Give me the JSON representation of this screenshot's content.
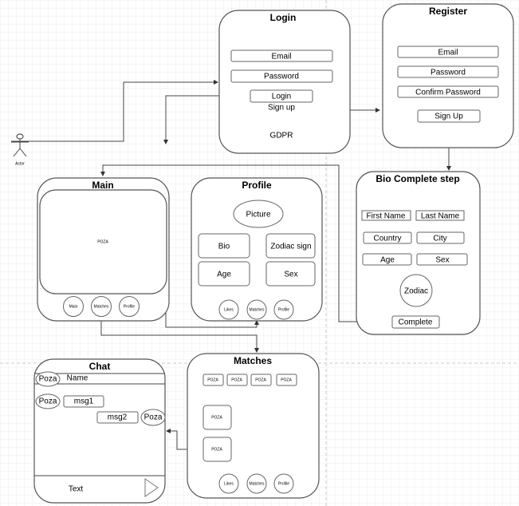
{
  "actor": {
    "label": "Actor"
  },
  "login": {
    "title": "Login",
    "email": "Email",
    "password": "Password",
    "login_button": "Login",
    "signup": "Sign up",
    "gdpr": "GDPR"
  },
  "register": {
    "title": "Register",
    "email": "Email",
    "password": "Password",
    "confirm": "Confirm Password",
    "signup_button": "Sign Up"
  },
  "bio": {
    "title": "Bio Complete step",
    "first_name": "First Name",
    "last_name": "Last Name",
    "country": "Country",
    "city": "City",
    "age": "Age",
    "sex": "Sex",
    "zodiac": "Zodiac",
    "complete": "Complete"
  },
  "main": {
    "title": "Main",
    "image": "POZA",
    "nav": [
      "Main",
      "Matches",
      "Profile"
    ]
  },
  "profile": {
    "title": "Profile",
    "picture": "Picture",
    "bio": "Bio",
    "zodiac": "Zodiac sign",
    "age": "Age",
    "sex": "Sex",
    "nav": [
      "Likes",
      "Matches",
      "Profile"
    ]
  },
  "chat": {
    "title": "Chat",
    "avatar": "Poza",
    "name": "Name",
    "msg1": "msg1",
    "msg2": "msg2",
    "input": "Text"
  },
  "matches": {
    "title": "Matches",
    "thumbs": [
      "POZA",
      "POZA",
      "POZA",
      "POZA"
    ],
    "cards": [
      "POZA",
      "POZA"
    ],
    "nav": [
      "Likes",
      "Matches",
      "Profile"
    ]
  }
}
